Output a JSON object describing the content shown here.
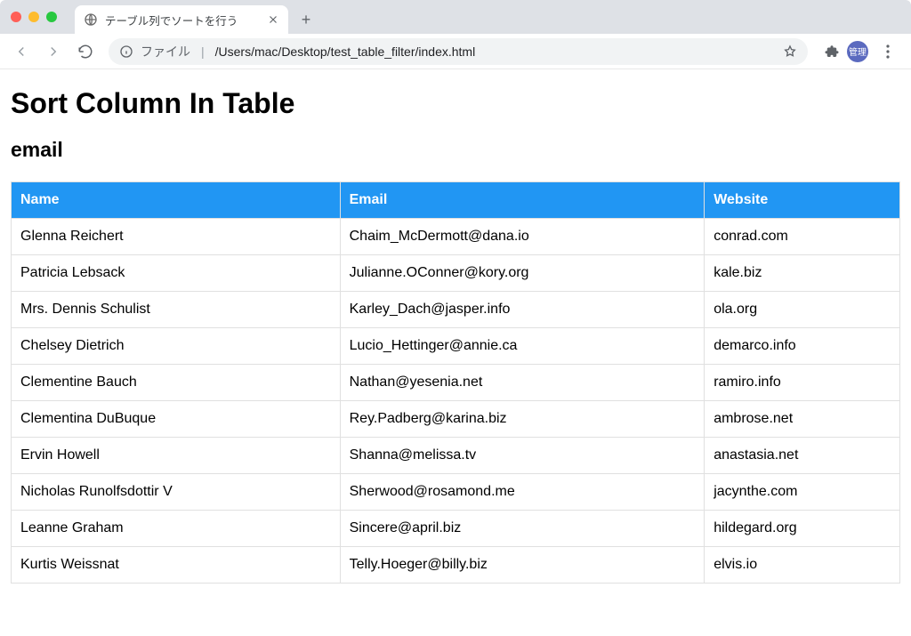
{
  "browser": {
    "tab_title": "テーブル列でソートを行う",
    "address_prefix": "ファイル",
    "address_path": "/Users/mac/Desktop/test_table_filter/index.html",
    "avatar_label": "管理"
  },
  "page": {
    "heading": "Sort Column In Table",
    "sort_label": "email",
    "columns": {
      "name": "Name",
      "email": "Email",
      "website": "Website"
    },
    "rows": [
      {
        "name": "Glenna Reichert",
        "email": "Chaim_McDermott@dana.io",
        "website": "conrad.com"
      },
      {
        "name": "Patricia Lebsack",
        "email": "Julianne.OConner@kory.org",
        "website": "kale.biz"
      },
      {
        "name": "Mrs. Dennis Schulist",
        "email": "Karley_Dach@jasper.info",
        "website": "ola.org"
      },
      {
        "name": "Chelsey Dietrich",
        "email": "Lucio_Hettinger@annie.ca",
        "website": "demarco.info"
      },
      {
        "name": "Clementine Bauch",
        "email": "Nathan@yesenia.net",
        "website": "ramiro.info"
      },
      {
        "name": "Clementina DuBuque",
        "email": "Rey.Padberg@karina.biz",
        "website": "ambrose.net"
      },
      {
        "name": "Ervin Howell",
        "email": "Shanna@melissa.tv",
        "website": "anastasia.net"
      },
      {
        "name": "Nicholas Runolfsdottir V",
        "email": "Sherwood@rosamond.me",
        "website": "jacynthe.com"
      },
      {
        "name": "Leanne Graham",
        "email": "Sincere@april.biz",
        "website": "hildegard.org"
      },
      {
        "name": "Kurtis Weissnat",
        "email": "Telly.Hoeger@billy.biz",
        "website": "elvis.io"
      }
    ]
  }
}
